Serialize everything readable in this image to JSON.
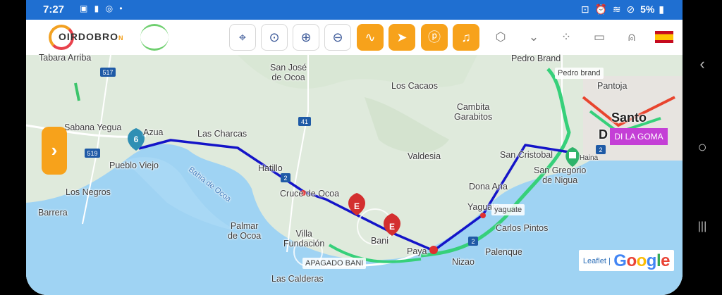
{
  "status_bar": {
    "time": "7:27",
    "left_icons": [
      "notification-icon",
      "alert-icon",
      "instagram-icon",
      "dot-icon"
    ],
    "battery": "5%"
  },
  "toolbar": {
    "logo_text": "OIRDOBRO",
    "logo_suffix": "N",
    "buttons": [
      "locate-icon",
      "pin-icon",
      "zoom-in-icon",
      "zoom-out-icon",
      "route-icon",
      "navigate-icon",
      "parking-icon",
      "bell-icon"
    ],
    "right_icons": [
      "hexagon-icon",
      "chevron-down-icon",
      "grid-icon",
      "chat-icon",
      "user-icon"
    ],
    "language_flag": "es"
  },
  "map": {
    "places": {
      "tabara_arriba": "Tabara Arriba",
      "san_jose_de_ocoa": "San José\nde Ocoa",
      "los_cacaos": "Los Cacaos",
      "pedro_brand": "Pedro Brand",
      "pantoja": "Pantoja",
      "santo": "Santo",
      "d": "D",
      "sabana_yegua": "Sabana Yegua",
      "azua": "Azua",
      "las_charcas": "Las Charcas",
      "pueblo_viejo": "Pueblo Viejo",
      "hatillo": "Hatillo",
      "cambita": "Cambita\nGarabitos",
      "valdesia": "Valdesia",
      "san_cristobal": "San Cristobal",
      "san_gregorio": "San Gregorio\nde Nigua",
      "los_negros": "Los Negros",
      "barrera": "Barrera",
      "cruce": "Cruce de Ocoa",
      "palmar": "Palmar\nde Ocoa",
      "villa_fundacion": "Villa\nFundación",
      "bani": "Bani",
      "paya": "Paya",
      "dona_ana": "Dona Ana",
      "yaguate": "Yaguate",
      "carlos_pintos": "Carlos Pintos",
      "palenque": "Palenque",
      "nizao": "Nizao",
      "las_calderas": "Las Calderas",
      "bahia": "Bahia de Ocoa",
      "haina": "Haina"
    },
    "tags": {
      "pedro_brand": "Pedro brand",
      "yaguate": "yaguate",
      "apagado": "APAGADO BANI",
      "diluna": "DI LA GOMA"
    },
    "cluster_count": "6",
    "markers": [
      "E",
      "E"
    ],
    "route_shields": [
      "517",
      "519",
      "41",
      "2",
      "2",
      "2"
    ],
    "attribution_leaflet": "Leaflet |",
    "attribution_google": "Google",
    "route_color": "#1414c8"
  },
  "nav_bar": {
    "back": "‹",
    "home": "○",
    "recents": "|||"
  }
}
